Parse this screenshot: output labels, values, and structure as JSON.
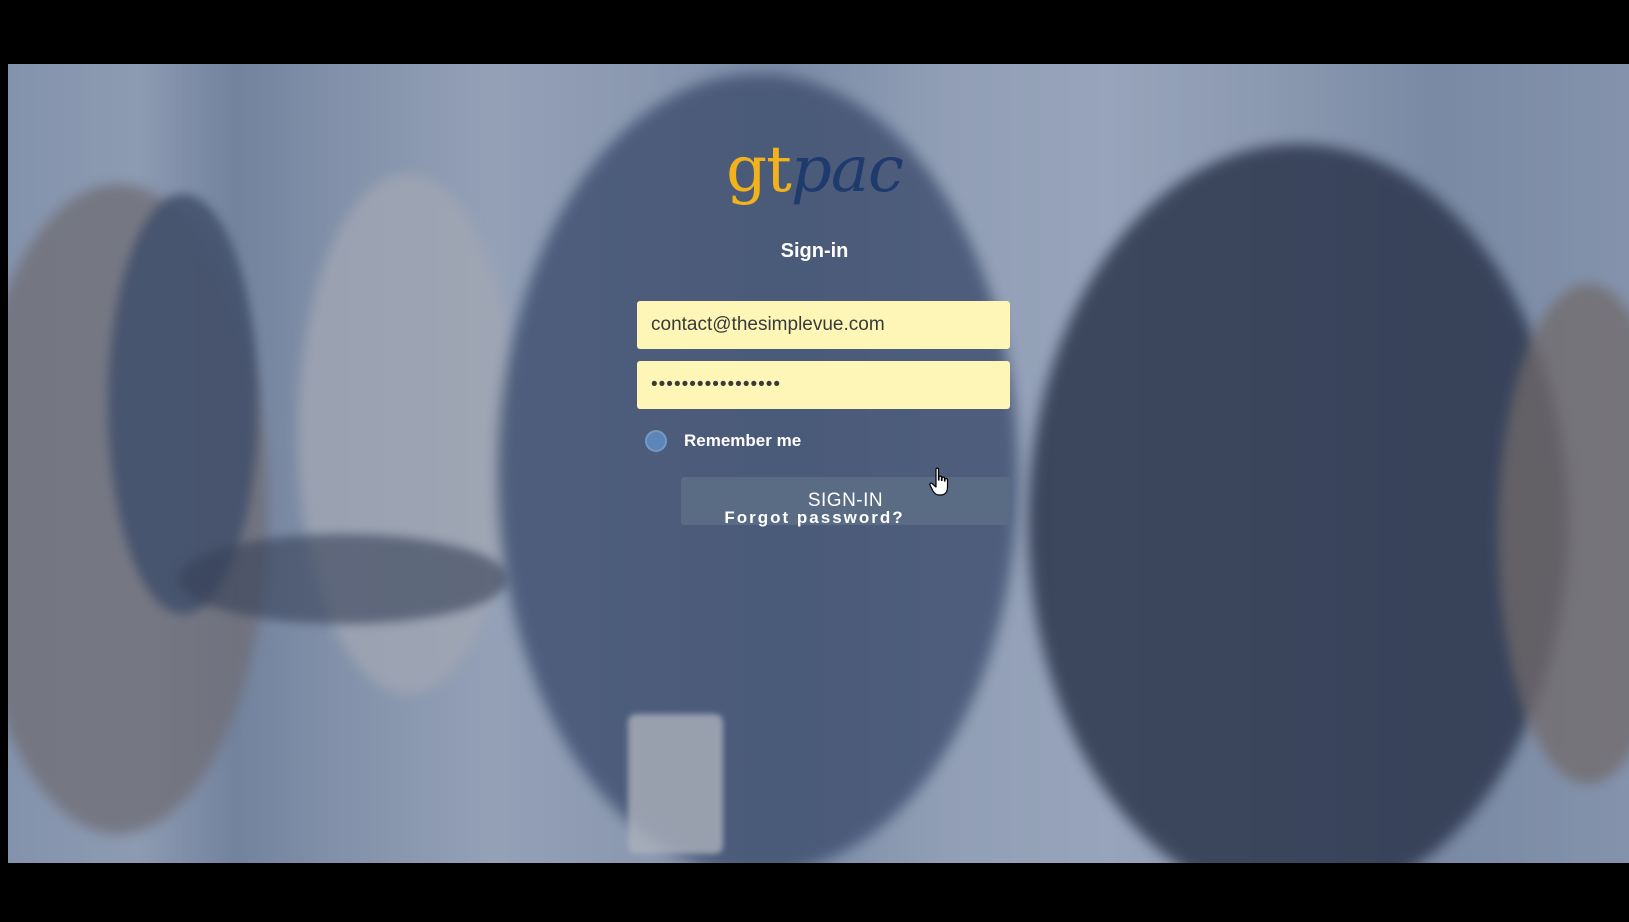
{
  "brand": {
    "logo_gt": "gt",
    "logo_pac": "pac",
    "gt_color": "#f2b21b",
    "pac_color": "#1f3a6d"
  },
  "form": {
    "title": "Sign-in",
    "email_value": "contact@thesimplevue.com",
    "password_value": "•••••••••••••••••",
    "remember_label": "Remember me",
    "submit_label": "SIGN-IN",
    "forgot_label": "Forgot password?"
  },
  "icons": {
    "cursor": "hand-pointer-icon",
    "remember": "radio-toggle-icon"
  },
  "colors": {
    "field_background": "#fdf6b6",
    "button_background": "#5a6b84",
    "overlay_tint": "#465f8c"
  }
}
